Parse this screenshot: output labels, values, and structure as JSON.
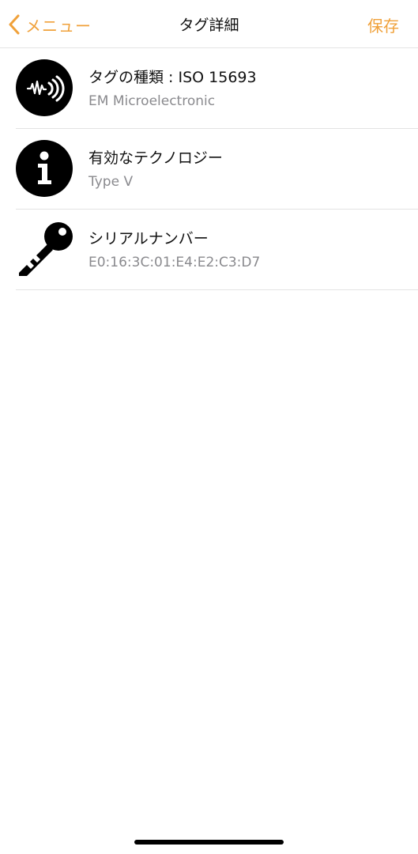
{
  "navbar": {
    "back_label": "メニュー",
    "title": "タグ詳細",
    "save_label": "保存",
    "accent_color": "#f0a13a"
  },
  "rows": [
    {
      "icon": "nfc-wave-icon",
      "title": "タグの種類 : ISO 15693",
      "subtitle": "EM Microelectronic"
    },
    {
      "icon": "info-icon",
      "title": "有効なテクノロジー",
      "subtitle": "Type V"
    },
    {
      "icon": "key-icon",
      "title": "シリアルナンバー",
      "subtitle": "E0:16:3C:01:E4:E2:C3:D7"
    }
  ]
}
